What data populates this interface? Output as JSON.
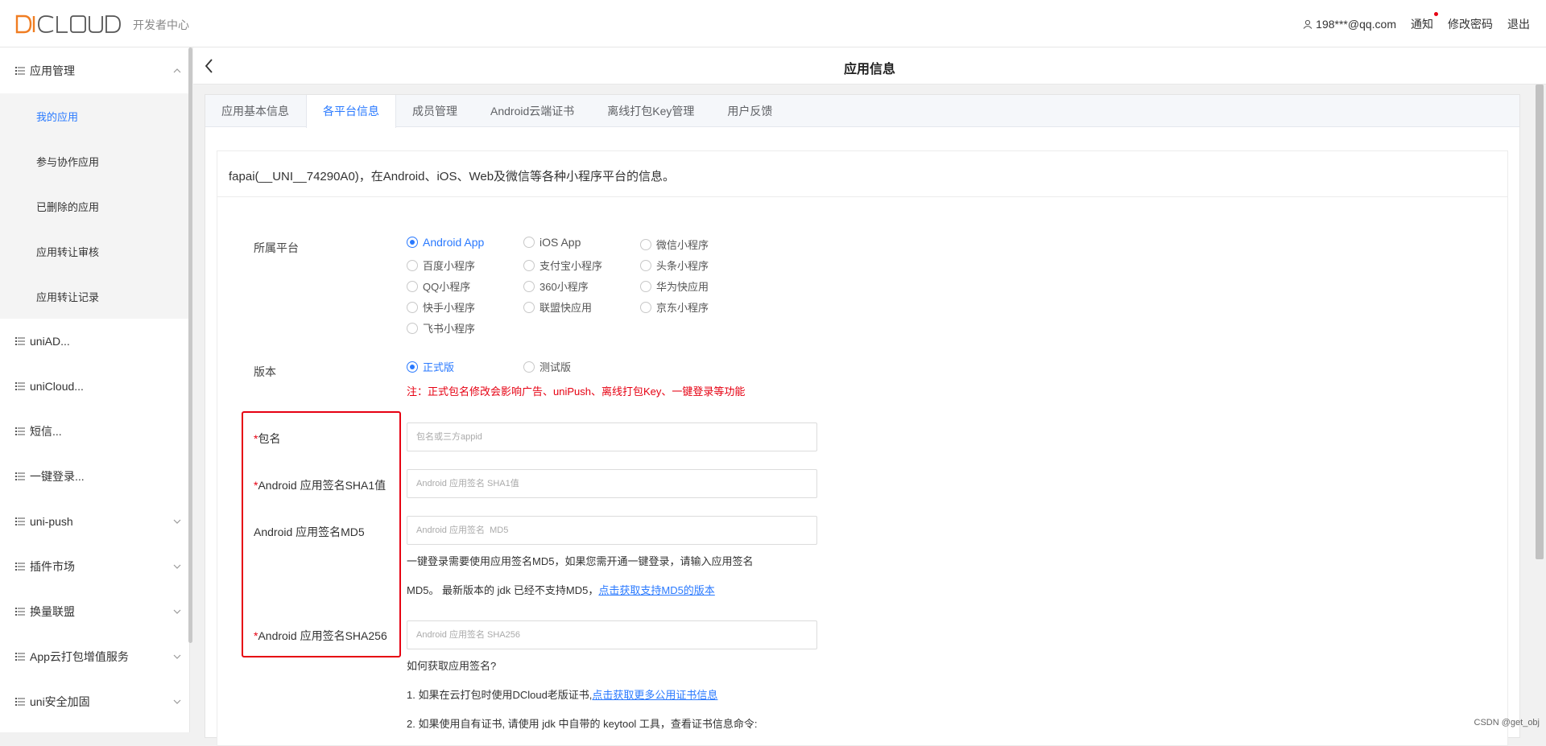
{
  "header": {
    "logo_text": "DCLOUD",
    "logo_sub": "开发者中心",
    "user": "198***@qq.com",
    "notify": "通知",
    "change_password": "修改密码",
    "logout": "退出"
  },
  "sidebar": {
    "app_manage": "应用管理",
    "sub_items": [
      "我的应用",
      "参与协作应用",
      "已删除的应用",
      "应用转让审核",
      "应用转让记录"
    ],
    "items": [
      "uniAD...",
      "uniCloud...",
      "短信...",
      "一键登录...",
      "uni-push",
      "插件市场",
      "换量联盟",
      "App云打包增值服务",
      "uni安全加固"
    ]
  },
  "page": {
    "title": "应用信息",
    "tabs": [
      "应用基本信息",
      "各平台信息",
      "成员管理",
      "Android云端证书",
      "离线打包Key管理",
      "用户反馈"
    ],
    "active_tab": "各平台信息",
    "intro": "fapai(__UNI__74290A0)，在Android、iOS、Web及微信等各种小程序平台的信息。"
  },
  "form": {
    "platform_label": "所属平台",
    "platforms": [
      "Android App",
      "iOS App",
      "微信小程序",
      "百度小程序",
      "支付宝小程序",
      "头条小程序",
      "QQ小程序",
      "360小程序",
      "华为快应用",
      "快手小程序",
      "联盟快应用",
      "京东小程序",
      "飞书小程序"
    ],
    "selected_platform": "Android App",
    "version_label": "版本",
    "versions": [
      "正式版",
      "测试版"
    ],
    "selected_version": "正式版",
    "version_note": "注：正式包名修改会影响广告、uniPush、离线打包Key、一键登录等功能",
    "required_mark": "*",
    "package_label": "包名",
    "package_placeholder": "包名或三方appid",
    "sha1_label": "Android 应用签名SHA1值",
    "sha1_placeholder": "Android 应用签名 SHA1值",
    "md5_label": "Android 应用签名MD5",
    "md5_placeholder": "Android 应用签名  MD5",
    "md5_help_1": "一键登录需要使用应用签名MD5，如果您需开通一键登录，请输入应用签名",
    "md5_help_2": "MD5。 最新版本的 jdk 已经不支持MD5，",
    "md5_help_link": "点击获取支持MD5的版本",
    "sha256_label": "Android 应用签名SHA256",
    "sha256_placeholder": "Android 应用签名 SHA256",
    "how_to": "如何获取应用签名?",
    "step1": "1. 如果在云打包时使用DCloud老版证书,",
    "step1_link": "点击获取更多公用证书信息",
    "step2": "2. 如果使用自有证书, 请使用 jdk 中自带的 keytool 工具，查看证书信息命令:"
  },
  "watermark": "CSDN @get_obj",
  "colors": {
    "accent": "#2979ff",
    "danger": "#e60012"
  }
}
